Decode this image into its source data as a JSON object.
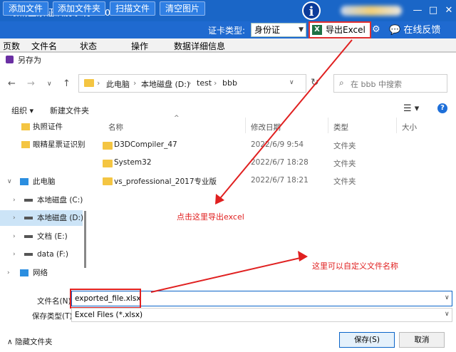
{
  "app": {
    "title": "眼精星票证识别系统V1.00.7",
    "toolbar": {
      "add_file": "添加文件",
      "add_folder": "添加文件夹",
      "scan_file": "扫描文件",
      "clear_images": "清空图片",
      "cert_type_label": "证卡类型:",
      "cert_type_value": "身份证",
      "export_excel": "导出Excel",
      "online_feedback": "在线反馈"
    },
    "grid_headers": [
      "页数",
      "文件名",
      "状态",
      "操作",
      "数据详细信息"
    ]
  },
  "dialog": {
    "title": "另存为",
    "breadcrumbs": [
      "此电脑",
      "本地磁盘 (D:)",
      "test",
      "bbb"
    ],
    "search_placeholder": "在 bbb 中搜索",
    "organize": "组织 ▾",
    "new_folder": "新建文件夹",
    "sidebar": [
      {
        "label": "执照证件",
        "icon": "folder-icon"
      },
      {
        "label": "眼精星票证识别",
        "icon": "folder-icon"
      },
      {
        "label": "此电脑",
        "icon": "computer-icon"
      },
      {
        "label": "本地磁盘 (C:)",
        "icon": "drive-icon"
      },
      {
        "label": "本地磁盘 (D:)",
        "icon": "drive-icon"
      },
      {
        "label": "文档 (E:)",
        "icon": "drive-icon"
      },
      {
        "label": "data (F:)",
        "icon": "drive-icon"
      },
      {
        "label": "网络",
        "icon": "network-icon"
      }
    ],
    "columns": [
      "名称",
      "修改日期",
      "类型",
      "大小"
    ],
    "files": [
      {
        "name": "D3DCompiler_47",
        "date": "2022/6/9 9:54",
        "type": "文件夹"
      },
      {
        "name": "System32",
        "date": "2022/6/7 18:28",
        "type": "文件夹"
      },
      {
        "name": "vs_professional_2017专业版",
        "date": "2022/6/7 18:21",
        "type": "文件夹"
      }
    ],
    "file_name_label": "文件名(N):",
    "file_name_value": "exported_file.xlsx",
    "file_type_label": "保存类型(T):",
    "file_type_value": "Excel Files (*.xlsx)",
    "hide_folders": "隐藏文件夹",
    "save": "保存(S)",
    "cancel": "取消"
  },
  "annotations": {
    "export_hint": "点击这里导出excel",
    "filename_hint": "这里可以自定义文件名称",
    "color": "#e02020"
  }
}
